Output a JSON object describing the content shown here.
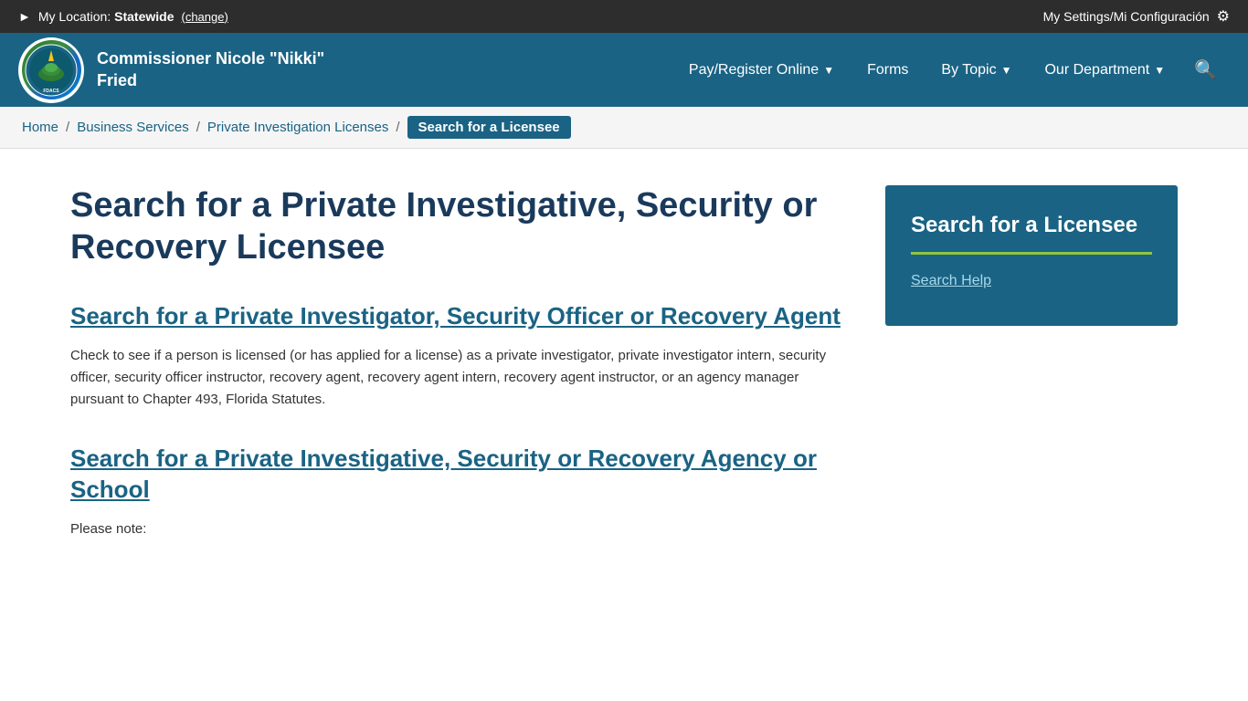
{
  "topbar": {
    "location_prefix": "My Location: Statewide",
    "location_bold": "Statewide",
    "change_label": "(change)",
    "settings_label": "My Settings/Mi Configuración"
  },
  "header": {
    "logo_alt": "Florida Department of Agriculture and Consumer Services",
    "commissioner_name": "Commissioner Nicole \"Nikki\" Fried",
    "nav": [
      {
        "label": "Pay/Register Online",
        "has_dropdown": true
      },
      {
        "label": "Forms",
        "has_dropdown": false
      },
      {
        "label": "By Topic",
        "has_dropdown": true
      },
      {
        "label": "Our Department",
        "has_dropdown": true
      }
    ]
  },
  "breadcrumb": {
    "items": [
      {
        "label": "Home",
        "href": "#"
      },
      {
        "label": "Business Services",
        "href": "#"
      },
      {
        "label": "Private Investigation Licenses",
        "href": "#"
      }
    ],
    "current": "Search for a Licensee"
  },
  "main": {
    "page_title": "Search for a Private Investigative, Security or Recovery Licensee",
    "sections": [
      {
        "heading": "Search for a Private Investigator, Security Officer or Recovery Agent",
        "body": "Check to see if a person is licensed (or has applied for a license) as a private investigator, private investigator intern, security officer, security officer instructor, recovery agent, recovery agent intern, recovery agent instructor, or an agency manager pursuant to Chapter 493, Florida Statutes."
      },
      {
        "heading": "Search for a Private Investigative, Security or Recovery Agency or School",
        "body": "Please note:"
      }
    ]
  },
  "sidebar": {
    "card_title": "Search for a Licensee",
    "search_help_label": "Search Help"
  }
}
